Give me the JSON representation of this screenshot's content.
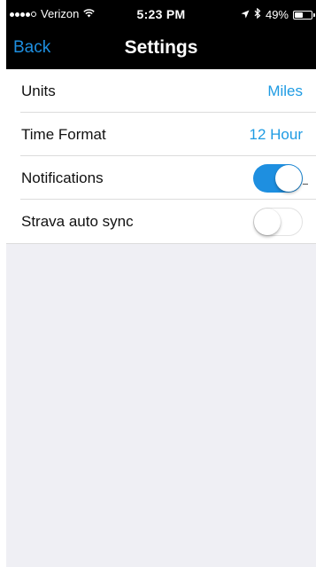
{
  "status_bar": {
    "carrier": "Verizon",
    "time": "5:23 PM",
    "battery_percent": "49%",
    "battery_level": 0.49
  },
  "nav": {
    "back_label": "Back",
    "title": "Settings"
  },
  "settings": {
    "units": {
      "label": "Units",
      "value": "Miles"
    },
    "time_format": {
      "label": "Time Format",
      "value": "12 Hour"
    },
    "notifications": {
      "label": "Notifications",
      "enabled": true
    },
    "strava": {
      "label": "Strava auto sync",
      "enabled": false
    }
  },
  "colors": {
    "accent": "#1e8fe0",
    "header_bg": "#000000",
    "empty_bg": "#efeff4"
  }
}
